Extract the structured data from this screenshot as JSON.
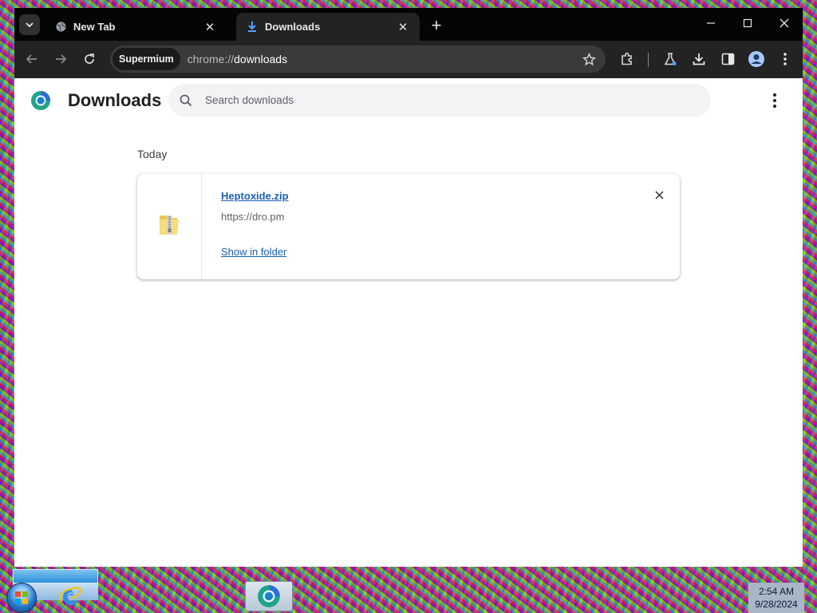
{
  "browser": {
    "tabs": [
      {
        "title": "New Tab",
        "active": false,
        "icon": "globe-icon"
      },
      {
        "title": "Downloads",
        "active": true,
        "icon": "download-icon"
      }
    ],
    "new_tab_label": "+",
    "window_controls": [
      "minimize-icon",
      "maximize-icon",
      "close-icon"
    ],
    "omnibox": {
      "chip": "Supermium",
      "url_scheme": "chrome://",
      "url_host": "downloads"
    },
    "toolbar_icons": [
      "back-icon",
      "forward-icon",
      "reload-icon",
      "bookmark-star-icon",
      "extensions-icon",
      "labs-flask-icon",
      "downloads-icon",
      "side-panel-icon",
      "profile-icon",
      "menu-icon"
    ]
  },
  "downloads_page": {
    "title": "Downloads",
    "search_placeholder": "Search downloads",
    "date_heading": "Today",
    "items": [
      {
        "file_name": "Heptoxide.zip",
        "source_url": "https://dro.pm",
        "action_label": "Show in folder",
        "icon": "zip-folder-icon"
      }
    ]
  },
  "taskbar": {
    "clock_time": "2:54 AM",
    "clock_date": "9/28/2024",
    "pinned": [
      "start-orb",
      "internet-explorer-icon",
      "supermium-browser-icon"
    ]
  },
  "colors": {
    "titlebar": "#050505",
    "toolbar": "#232323",
    "link": "#1a5fb4",
    "search_bg": "#f1f3f4"
  }
}
